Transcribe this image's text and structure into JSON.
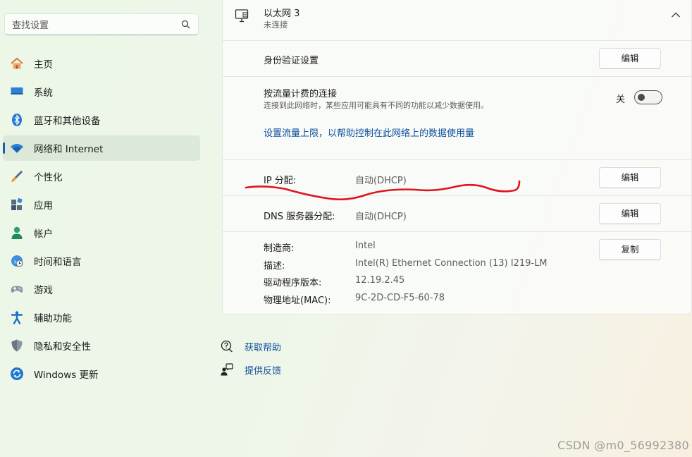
{
  "search": {
    "placeholder": "查找设置"
  },
  "sidebar": {
    "items": [
      {
        "label": "主页",
        "icon": "home-icon"
      },
      {
        "label": "系统",
        "icon": "monitor-icon"
      },
      {
        "label": "蓝牙和其他设备",
        "icon": "bluetooth-icon"
      },
      {
        "label": "网络和 Internet",
        "icon": "wifi-icon",
        "active": true
      },
      {
        "label": "个性化",
        "icon": "brush-icon"
      },
      {
        "label": "应用",
        "icon": "apps-icon"
      },
      {
        "label": "帐户",
        "icon": "person-icon"
      },
      {
        "label": "时间和语言",
        "icon": "globe-clock-icon"
      },
      {
        "label": "游戏",
        "icon": "gamepad-icon"
      },
      {
        "label": "辅助功能",
        "icon": "accessibility-icon"
      },
      {
        "label": "隐私和安全性",
        "icon": "shield-icon"
      },
      {
        "label": "Windows 更新",
        "icon": "windows-update-icon"
      }
    ]
  },
  "adapter": {
    "name": "以太网 3",
    "status": "未连接"
  },
  "auth": {
    "label": "身份验证设置",
    "button": "编辑"
  },
  "metered": {
    "label": "按流量计费的连接",
    "description": "连接到此网络时，某些应用可能具有不同的功能以减少数据使用。",
    "toggle_state": "关",
    "toggle_on": false,
    "link": "设置流量上限，以帮助控制在此网络上的数据使用量"
  },
  "ip": {
    "label": "IP 分配:",
    "value": "自动(DHCP)",
    "button": "编辑"
  },
  "dns": {
    "label": "DNS 服务器分配:",
    "value": "自动(DHCP)",
    "button": "编辑"
  },
  "properties": {
    "button": "复制",
    "rows": [
      {
        "label": "制造商:",
        "value": "Intel"
      },
      {
        "label": "描述:",
        "value": "Intel(R) Ethernet Connection (13) I219-LM"
      },
      {
        "label": "驱动程序版本:",
        "value": "12.19.2.45"
      },
      {
        "label": "物理地址(MAC):",
        "value": "9C-2D-CD-F5-60-78"
      }
    ]
  },
  "help": {
    "get_help": "获取帮助",
    "feedback": "提供反馈"
  },
  "watermark": "CSDN @m0_56992380",
  "colors": {
    "accent": "#1a5fb4",
    "link": "#0f4f9c",
    "annotation": "#e0141e"
  }
}
